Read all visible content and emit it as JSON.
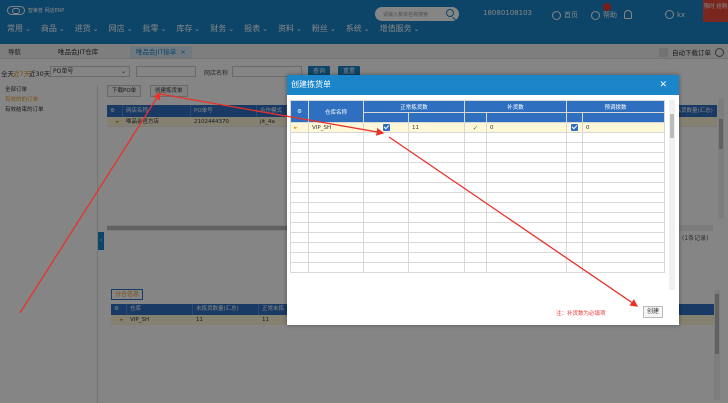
{
  "app": {
    "logo_text": "智莱普 网店ERP"
  },
  "topbar": {
    "menu": [
      {
        "label": "常用"
      },
      {
        "label": "商品"
      },
      {
        "label": "进货"
      },
      {
        "label": "网店"
      },
      {
        "label": "批零"
      },
      {
        "label": "库存"
      },
      {
        "label": "财务"
      },
      {
        "label": "报表"
      },
      {
        "label": "资料"
      },
      {
        "label": "粉丝"
      },
      {
        "label": "系统"
      },
      {
        "label": "增值服务"
      }
    ],
    "search_placeholder": "请输入菜单名称搜索",
    "phone": "18080108103",
    "home_label": "首页",
    "help_label": "帮助",
    "user_label": "kx",
    "promo_text": "限时 抢购"
  },
  "tabs": {
    "nav_label": "导航",
    "tab1": "唯品会JIT仓库",
    "tab2": "唯品会JIT接单",
    "auto_download": "自动下载订单"
  },
  "filter": {
    "all": "全天",
    "recent7": "近7天",
    "recent30": "近30天",
    "po_select": "PO单号",
    "shop_label": "网店名称",
    "query_btn": "查询",
    "reset_btn": "重置"
  },
  "sidebar": {
    "items": [
      {
        "label": "全部订单"
      },
      {
        "label": "有效的的订单"
      },
      {
        "label": "有效结束的订单"
      }
    ]
  },
  "main": {
    "download_po_btn": "下载PO单",
    "create_pick_btn": "创建拣货单",
    "columns": [
      "网店名称",
      "PO单号",
      "合作模式",
      "",
      "",
      "",
      "",
      "",
      "",
      "",
      "未拣货数量(汇总)"
    ],
    "rows": [
      {
        "shop": "唯品会官方店",
        "po": "2102444370",
        "mode": "jit_4a"
      }
    ],
    "total_text": "(1条记录)",
    "lower_tab": "分仓信息",
    "lower_columns": [
      "仓库",
      "未拣货数量(汇总)",
      "正常未拣"
    ],
    "lower_rows": [
      {
        "warehouse": "VIP_SH",
        "unpicked": "11",
        "normal": "11"
      }
    ]
  },
  "modal": {
    "title": "创建拣货单",
    "col_warehouse": "仓库名称",
    "col_normal": "正常拣货数",
    "col_supply": "补货数",
    "col_preset": "预调拨数",
    "row": {
      "warehouse": "VIP_SH",
      "normal_qty": "11",
      "supply_qty": "0",
      "preset_qty": "0"
    },
    "note": "注：补货数为必填项",
    "create_btn": "创建"
  },
  "colors": {
    "primary": "#1a85c9",
    "header_blue": "#2e6fc0",
    "accent_orange": "#e89e1b",
    "arrow_red": "#e8322b"
  }
}
